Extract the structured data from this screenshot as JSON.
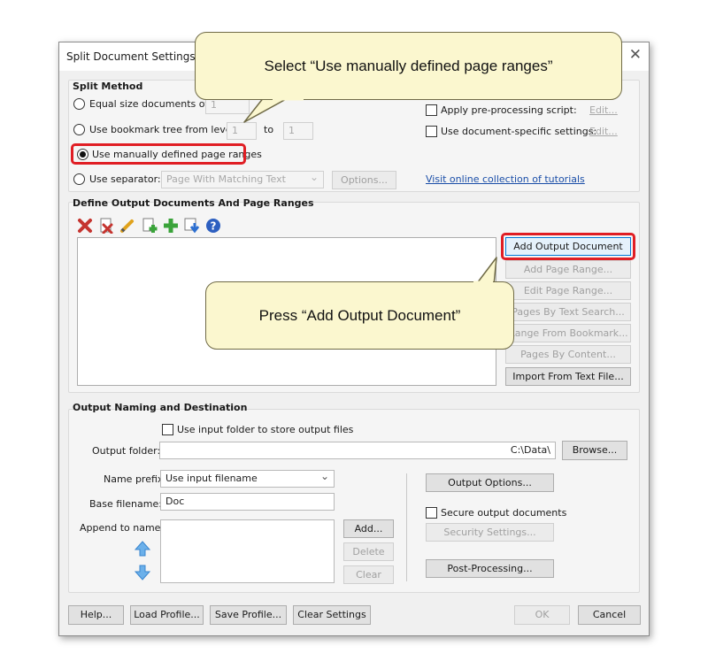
{
  "window": {
    "title": "Split Document Settings (A",
    "close_glyph": "✕"
  },
  "split_method": {
    "title": "Split Method",
    "equal_size_label": "Equal size documents of",
    "equal_size_value": "1",
    "bookmark_label": "Use bookmark tree from level",
    "bookmark_from": "1",
    "bookmark_to_label": "to",
    "bookmark_to": "1",
    "manual_label": "Use manually defined page ranges",
    "separator_label": "Use separator:",
    "separator_value": "Page With Matching Text",
    "options_button": "Options...",
    "preprocess_label": "Apply pre-processing script:",
    "preprocess_edit": "Edit...",
    "docspecific_label": "Use document-specific settings:",
    "docspecific_edit": "Edit...",
    "tutorials_link": "Visit online collection of tutorials",
    "selected": "manual"
  },
  "define_output": {
    "title": "Define Output Documents And Page Ranges",
    "toolbar_icons": [
      "delete-icon",
      "delete-document-icon",
      "edit-pencil-icon",
      "add-document-icon",
      "add-plus-icon",
      "move-down-icon",
      "help-icon"
    ],
    "buttons": {
      "add_output": "Add Output Document",
      "add_page_range": "Add Page Range...",
      "edit_page_range": "Edit Page Range...",
      "pages_by_text": "Pages By Text Search...",
      "range_from_bookmark": "Range From Bookmark...",
      "pages_by_content": "Pages By Content...",
      "import_text": "Import From Text File..."
    }
  },
  "output_naming": {
    "title": "Output Naming and Destination",
    "use_input_folder": "Use input folder to store output files",
    "output_folder_label": "Output folder:",
    "output_folder_value": "C:\\Data\\",
    "browse": "Browse...",
    "name_prefix_label": "Name prefix:",
    "name_prefix_value": "Use input filename",
    "base_filename_label": "Base filename:",
    "base_filename_value": "Doc",
    "append_label": "Append to name:",
    "add": "Add...",
    "delete": "Delete",
    "clear": "Clear",
    "output_options": "Output Options...",
    "secure_label": "Secure output documents",
    "security_settings": "Security Settings...",
    "post_processing": "Post-Processing..."
  },
  "footer": {
    "help": "Help...",
    "load_profile": "Load Profile...",
    "save_profile": "Save Profile...",
    "clear_settings": "Clear Settings",
    "ok": "OK",
    "cancel": "Cancel"
  },
  "callouts": {
    "top": "Select “Use manually defined page ranges”",
    "middle": "Press “Add Output Document”"
  },
  "colors": {
    "highlight": "#e01e24",
    "callout_fill": "#fbf7cf",
    "link": "#1a4ea8"
  }
}
